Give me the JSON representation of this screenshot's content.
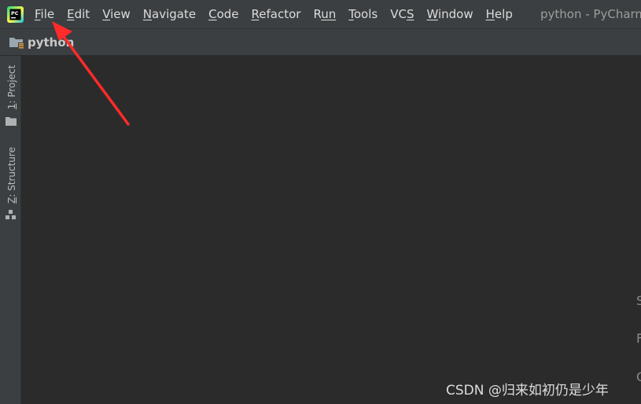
{
  "menubar": {
    "app_icon": "pycharm-logo-icon",
    "items": [
      {
        "mnemonic": "F",
        "rest": "ile"
      },
      {
        "mnemonic": "E",
        "rest": "dit"
      },
      {
        "mnemonic": "V",
        "rest": "iew"
      },
      {
        "mnemonic": "N",
        "rest": "avigate"
      },
      {
        "mnemonic": "C",
        "rest": "ode"
      },
      {
        "mnemonic": "R",
        "rest": "efactor"
      },
      {
        "mnemonic": "R",
        "rest": "un",
        "alt_style": "u-underlined"
      },
      {
        "mnemonic": "T",
        "rest": "ools"
      },
      {
        "pre": "VC",
        "mnemonic": "S",
        "rest": ""
      },
      {
        "mnemonic": "W",
        "rest": "indow"
      },
      {
        "mnemonic": "H",
        "rest": "elp"
      }
    ],
    "window_title": "python - PyCharm"
  },
  "navbar": {
    "icon": "project-folder-icon",
    "label": "python"
  },
  "side_strip": {
    "tabs": [
      {
        "mnemonic": "1",
        "rest": ": Project",
        "icon": "folder-icon"
      },
      {
        "mnemonic": "Z",
        "rest": ": Structure",
        "icon": "structure-icon"
      }
    ]
  },
  "editor": {
    "hints": [
      "S",
      "F",
      "G"
    ]
  },
  "watermark": "CSDN @归来如初仍是少年",
  "annotation": {
    "type": "arrow",
    "color": "#ff2a2a",
    "points_to": "File"
  }
}
